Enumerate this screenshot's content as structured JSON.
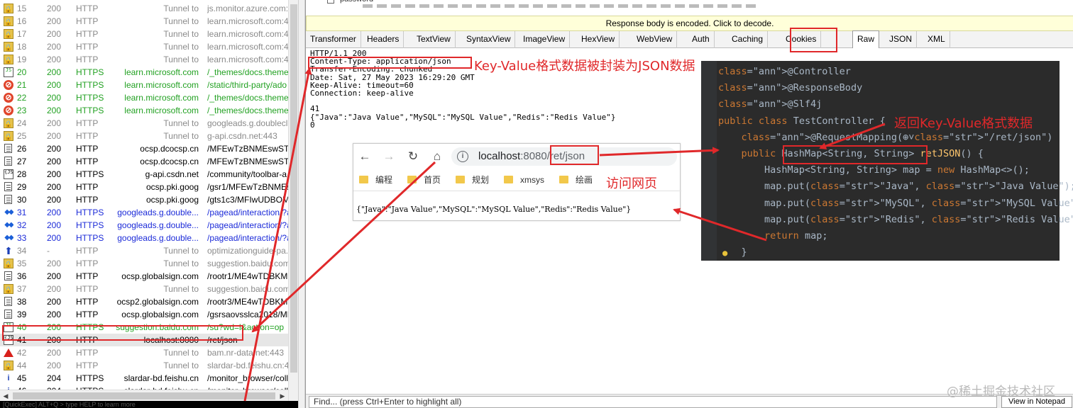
{
  "sessions": [
    {
      "num": "15",
      "result": "200",
      "protocol": "HTTP",
      "host": "Tunnel to",
      "url": "js.monitor.azure.com:",
      "icon": "lock-icon",
      "color": "gray"
    },
    {
      "num": "16",
      "result": "200",
      "protocol": "HTTP",
      "host": "Tunnel to",
      "url": "learn.microsoft.com:4",
      "icon": "lock-icon",
      "color": "gray"
    },
    {
      "num": "17",
      "result": "200",
      "protocol": "HTTP",
      "host": "Tunnel to",
      "url": "learn.microsoft.com:4",
      "icon": "lock-icon",
      "color": "gray"
    },
    {
      "num": "18",
      "result": "200",
      "protocol": "HTTP",
      "host": "Tunnel to",
      "url": "learn.microsoft.com:4",
      "icon": "lock-icon",
      "color": "gray"
    },
    {
      "num": "19",
      "result": "200",
      "protocol": "HTTP",
      "host": "Tunnel to",
      "url": "learn.microsoft.com:4",
      "icon": "lock-icon",
      "color": "gray"
    },
    {
      "num": "20",
      "result": "200",
      "protocol": "HTTPS",
      "host": "learn.microsoft.com",
      "url": "/_themes/docs.theme",
      "icon": "js-icon",
      "color": "green"
    },
    {
      "num": "21",
      "result": "200",
      "protocol": "HTTPS",
      "host": "learn.microsoft.com",
      "url": "/static/third-party/ado",
      "icon": "blocked-icon",
      "color": "green"
    },
    {
      "num": "22",
      "result": "200",
      "protocol": "HTTPS",
      "host": "learn.microsoft.com",
      "url": "/_themes/docs.theme",
      "icon": "blocked-icon",
      "color": "green"
    },
    {
      "num": "23",
      "result": "200",
      "protocol": "HTTPS",
      "host": "learn.microsoft.com",
      "url": "/_themes/docs.theme",
      "icon": "blocked-icon",
      "color": "green"
    },
    {
      "num": "24",
      "result": "200",
      "protocol": "HTTP",
      "host": "Tunnel to",
      "url": "googleads.g.doublecli",
      "icon": "lock-icon",
      "color": "gray"
    },
    {
      "num": "25",
      "result": "200",
      "protocol": "HTTP",
      "host": "Tunnel to",
      "url": "g-api.csdn.net:443",
      "icon": "lock-icon",
      "color": "gray"
    },
    {
      "num": "26",
      "result": "200",
      "protocol": "HTTP",
      "host": "ocsp.dcocsp.cn",
      "url": "/MFEwTzBNMEswSTAJ",
      "icon": "document-icon",
      "color": "black"
    },
    {
      "num": "27",
      "result": "200",
      "protocol": "HTTP",
      "host": "ocsp.dcocsp.cn",
      "url": "/MFEwTzBNMEswSTAJ",
      "icon": "document-icon",
      "color": "black"
    },
    {
      "num": "28",
      "result": "200",
      "protocol": "HTTPS",
      "host": "g-api.csdn.net",
      "url": "/community/toolbar-a",
      "icon": "json-icon",
      "color": "black"
    },
    {
      "num": "29",
      "result": "200",
      "protocol": "HTTP",
      "host": "ocsp.pki.goog",
      "url": "/gsr1/MFEwTzBNMEsw",
      "icon": "document-icon",
      "color": "black"
    },
    {
      "num": "30",
      "result": "200",
      "protocol": "HTTP",
      "host": "ocsp.pki.goog",
      "url": "/gts1c3/MFIwUDBOME",
      "icon": "document-icon",
      "color": "black"
    },
    {
      "num": "31",
      "result": "200",
      "protocol": "HTTPS",
      "host": "googleads.g.double...",
      "url": "/pagead/interaction/?a",
      "icon": "arrows-icon",
      "color": "blue"
    },
    {
      "num": "32",
      "result": "200",
      "protocol": "HTTPS",
      "host": "googleads.g.double...",
      "url": "/pagead/interaction/?a",
      "icon": "arrows-icon",
      "color": "blue"
    },
    {
      "num": "33",
      "result": "200",
      "protocol": "HTTPS",
      "host": "googleads.g.double...",
      "url": "/pagead/interaction/?a",
      "icon": "arrows-icon",
      "color": "blue"
    },
    {
      "num": "34",
      "result": "-",
      "protocol": "HTTP",
      "host": "Tunnel to",
      "url": "optimizationguide-pa.g",
      "icon": "upload-icon",
      "color": "gray"
    },
    {
      "num": "35",
      "result": "200",
      "protocol": "HTTP",
      "host": "Tunnel to",
      "url": "suggestion.baidu.com:",
      "icon": "lock-icon",
      "color": "gray"
    },
    {
      "num": "36",
      "result": "200",
      "protocol": "HTTP",
      "host": "ocsp.globalsign.com",
      "url": "/rootr1/ME4wTDBKME",
      "icon": "document-icon",
      "color": "black"
    },
    {
      "num": "37",
      "result": "200",
      "protocol": "HTTP",
      "host": "Tunnel to",
      "url": "suggestion.baidu.com:",
      "icon": "lock-icon",
      "color": "gray"
    },
    {
      "num": "38",
      "result": "200",
      "protocol": "HTTP",
      "host": "ocsp2.globalsign.com",
      "url": "/rootr3/ME4wTDBKME",
      "icon": "document-icon",
      "color": "black"
    },
    {
      "num": "39",
      "result": "200",
      "protocol": "HTTP",
      "host": "ocsp.globalsign.com",
      "url": "/gsrsaovsslca2018/ME",
      "icon": "document-icon",
      "color": "black"
    },
    {
      "num": "40",
      "result": "200",
      "protocol": "HTTPS",
      "host": "suggestion.baidu.com",
      "url": "/su?wd=l&action=op",
      "icon": "js-icon",
      "color": "green"
    },
    {
      "num": "41",
      "result": "200",
      "protocol": "HTTP",
      "host": "localhost:8080",
      "url": "/ret/json",
      "icon": "json-icon",
      "color": "black",
      "selected": true
    },
    {
      "num": "42",
      "result": "200",
      "protocol": "HTTP",
      "host": "Tunnel to",
      "url": "bam.nr-data.net:443",
      "icon": "warning-icon",
      "color": "gray"
    },
    {
      "num": "44",
      "result": "200",
      "protocol": "HTTP",
      "host": "Tunnel to",
      "url": "slardar-bd.feishu.cn:4",
      "icon": "lock-icon",
      "color": "gray"
    },
    {
      "num": "45",
      "result": "204",
      "protocol": "HTTPS",
      "host": "slardar-bd.feishu.cn",
      "url": "/monitor_browser/colle",
      "icon": "info-icon",
      "color": "black"
    },
    {
      "num": "46",
      "result": "204",
      "protocol": "HTTPS",
      "host": "slardar-bd.feishu.cn",
      "url": "/monitor_browser/colle",
      "icon": "info-icon",
      "color": "black"
    }
  ],
  "quickexec": "[QuickExec] ALT+Q > type HELP to learn more",
  "top_strip": {
    "label": "password"
  },
  "banner": "Response body is encoded. Click to decode.",
  "tabs": [
    "Transformer",
    "Headers",
    "TextView",
    "SyntaxView",
    "ImageView",
    "HexView",
    "WebView",
    "Auth",
    "Caching",
    "Cookies",
    "Raw",
    "JSON",
    "XML"
  ],
  "active_tab": "Raw",
  "raw_lines": [
    "HTTP/1.1 200",
    "Content-Type: application/json",
    "Transfer-Encoding: chunked",
    "Date: Sat, 27 May 2023 16:29:20 GMT",
    "Keep-Alive: timeout=60",
    "Connection: keep-alive",
    "",
    "41",
    "{\"Java\":\"Java Value\",\"MySQL\":\"MySQL Value\",\"Redis\":\"Redis Value\"}",
    "0"
  ],
  "find_placeholder": "Find... (press Ctrl+Enter to highlight all)",
  "find_button": "View in Notepad",
  "browser": {
    "url_host": "localhost",
    "url_port": ":8080",
    "url_path": "/ret/json",
    "bookmarks": [
      "编程",
      "首页",
      "规划",
      "xmsys",
      "绘画"
    ],
    "body": "{\"Java\":\"Java Value\",\"MySQL\":\"MySQL Value\",\"Redis\":\"Redis Value\"}"
  },
  "code_lines": [
    "@Controller",
    "@ResponseBody",
    "@Slf4j",
    "public class TestController {",
    "    @RequestMapping(⊕˅\"/ret/json\")",
    "    public HashMap<String, String> retJSON() {",
    "        HashMap<String, String> map = new HashMap<>();",
    "        map.put(\"Java\", \"Java Value\");",
    "        map.put(\"MySQL\", \"MySQL Value\");",
    "        map.put(\"Redis\", \"Redis Value\");",
    "        return map;",
    "    }"
  ],
  "annotations": {
    "json_note": "Key-Value格式数据被封装为JSON数据",
    "return_note": "返回Key-Value格式数据",
    "visit_note": "访问网页"
  },
  "colors": {
    "annotation": "#e0282a",
    "ide_bg": "#2b2b2b",
    "banner_bg": "#ffffd9"
  },
  "watermark": "@稀土掘金技术社区"
}
